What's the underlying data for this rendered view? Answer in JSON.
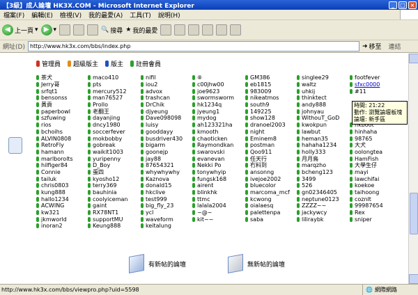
{
  "window": {
    "title": "【3級】成人論壇 HK3X.COM - Microsoft Internet Explorer"
  },
  "menu": [
    "檔案(F)",
    "編輯(E)",
    "檢視(V)",
    "我的最愛(A)",
    "工具(T)",
    "說明(H)"
  ],
  "toolbar": {
    "back": "上一頁",
    "search": "搜尋",
    "favorites": "我的最愛"
  },
  "address": {
    "label": "網址(D)",
    "url": "http://www.hk3x.com/bbs/index.php",
    "go": "移至",
    "links": "連結"
  },
  "roles": [
    "管理員",
    "超級版主",
    "版主",
    "註冊會員"
  ],
  "users": [
    [
      "茶犬",
      "maco410",
      "nifil",
      "⑧",
      "GM386",
      "singlee29",
      "footfever"
    ],
    [
      "Jerry哥",
      "pts",
      "iou2",
      "c00jhw00",
      "eb1815",
      "waltz",
      "sfxc0000"
    ],
    [
      "srfqt1",
      "mercury512",
      "advox",
      "joe9623",
      "983009",
      "uhkij",
      "#11"
    ],
    [
      "bensonss",
      "man76527",
      "trashcan",
      "swormsworm",
      "nikeatmos",
      "thinktect",
      ""
    ],
    [
      "黃貢",
      "Prollo",
      "DrChik",
      "hk1234q",
      "south9",
      "andy888",
      ""
    ],
    [
      "paperbowl",
      "老翻王",
      "djyeung",
      "jyeung1",
      "149225",
      "johnyau",
      ""
    ],
    [
      "szfuwing",
      "dayanjing",
      "Dave098098",
      "mydog",
      "show128",
      "WithouT_GoD",
      ""
    ],
    [
      "rios",
      "dncy1980",
      "luisy",
      "ah123321ha",
      "dranoel2003",
      "kwokpun",
      "hkboot"
    ],
    [
      "bchoihs",
      "soccerfever",
      "gooddayy",
      "kmooth",
      "night",
      "lawbut",
      "hinhaha"
    ],
    [
      "ALVIN0808",
      "mokbobby",
      "busdriver430",
      "chaoticken",
      "Eminem8",
      "heman35",
      "98765"
    ],
    [
      "RetroFly",
      "gobreak",
      "bigarm",
      "Raymondkan",
      "postman",
      "hahaha1234",
      "大犬"
    ],
    [
      "hamann",
      "waikit1003",
      "goonejp",
      "swarovski",
      "Qoo911",
      "holly333",
      "oolongtea"
    ],
    [
      "marlborolts",
      "yuripenny",
      "jay88",
      "evanevan",
      "任天行",
      "月月鳥",
      "HamFish"
    ],
    [
      "hilfiger84",
      "D_Boy",
      "87654321",
      "Nekki Po",
      "冇料到",
      "marqzho",
      "大學生仔"
    ],
    [
      "Connie",
      "蛋四",
      "whywhywhy",
      "tonywhyip",
      "ansonng",
      "bcheng123",
      "mayi"
    ],
    [
      "tailuk",
      "kyosho12",
      "Kaznova",
      "fungsk168",
      "ivejoe2002",
      "3499",
      "lawchifai"
    ],
    [
      "chris0803",
      "terry369",
      "donald15",
      "airent",
      "bluecolor",
      "526",
      "koekoe"
    ],
    [
      "kung888",
      "bauhinia",
      "hkclive",
      "blinkhk",
      "marcoma_mcf",
      "gn02346405",
      "taihoong"
    ],
    [
      "hallo1234",
      "coolyiceman",
      "test999",
      "ttmc",
      "kcwong",
      "neptune0123",
      "coznlt"
    ],
    [
      "ACWING",
      "gaint",
      "big_fly_23",
      "lalala2004",
      "oialaesq",
      "ZZZZ~~",
      "99987654"
    ],
    [
      "kw321",
      "RX78NT1",
      "ycl",
      "~@~",
      "palettenpa",
      "jackywcy",
      "Rex"
    ],
    [
      "jkmworld",
      "supportMU",
      "waveform",
      "kit~~",
      "saba",
      "liliraybk",
      "sniper"
    ],
    [
      "inoran2",
      "Keung888",
      "keitalung",
      "",
      "",
      "",
      ""
    ]
  ],
  "tooltip": {
    "time": "時間: 21:22",
    "action": "動作: 瀏覽論壇板塊",
    "forum": "論壇: 新手區"
  },
  "legend": {
    "new": "有新帖的論壇",
    "nonew": "無新帖的論壇"
  },
  "status": {
    "url": "http://www.hk3x.com/bbs/viewpro.php?uid=5598",
    "zone": "網際網路"
  }
}
